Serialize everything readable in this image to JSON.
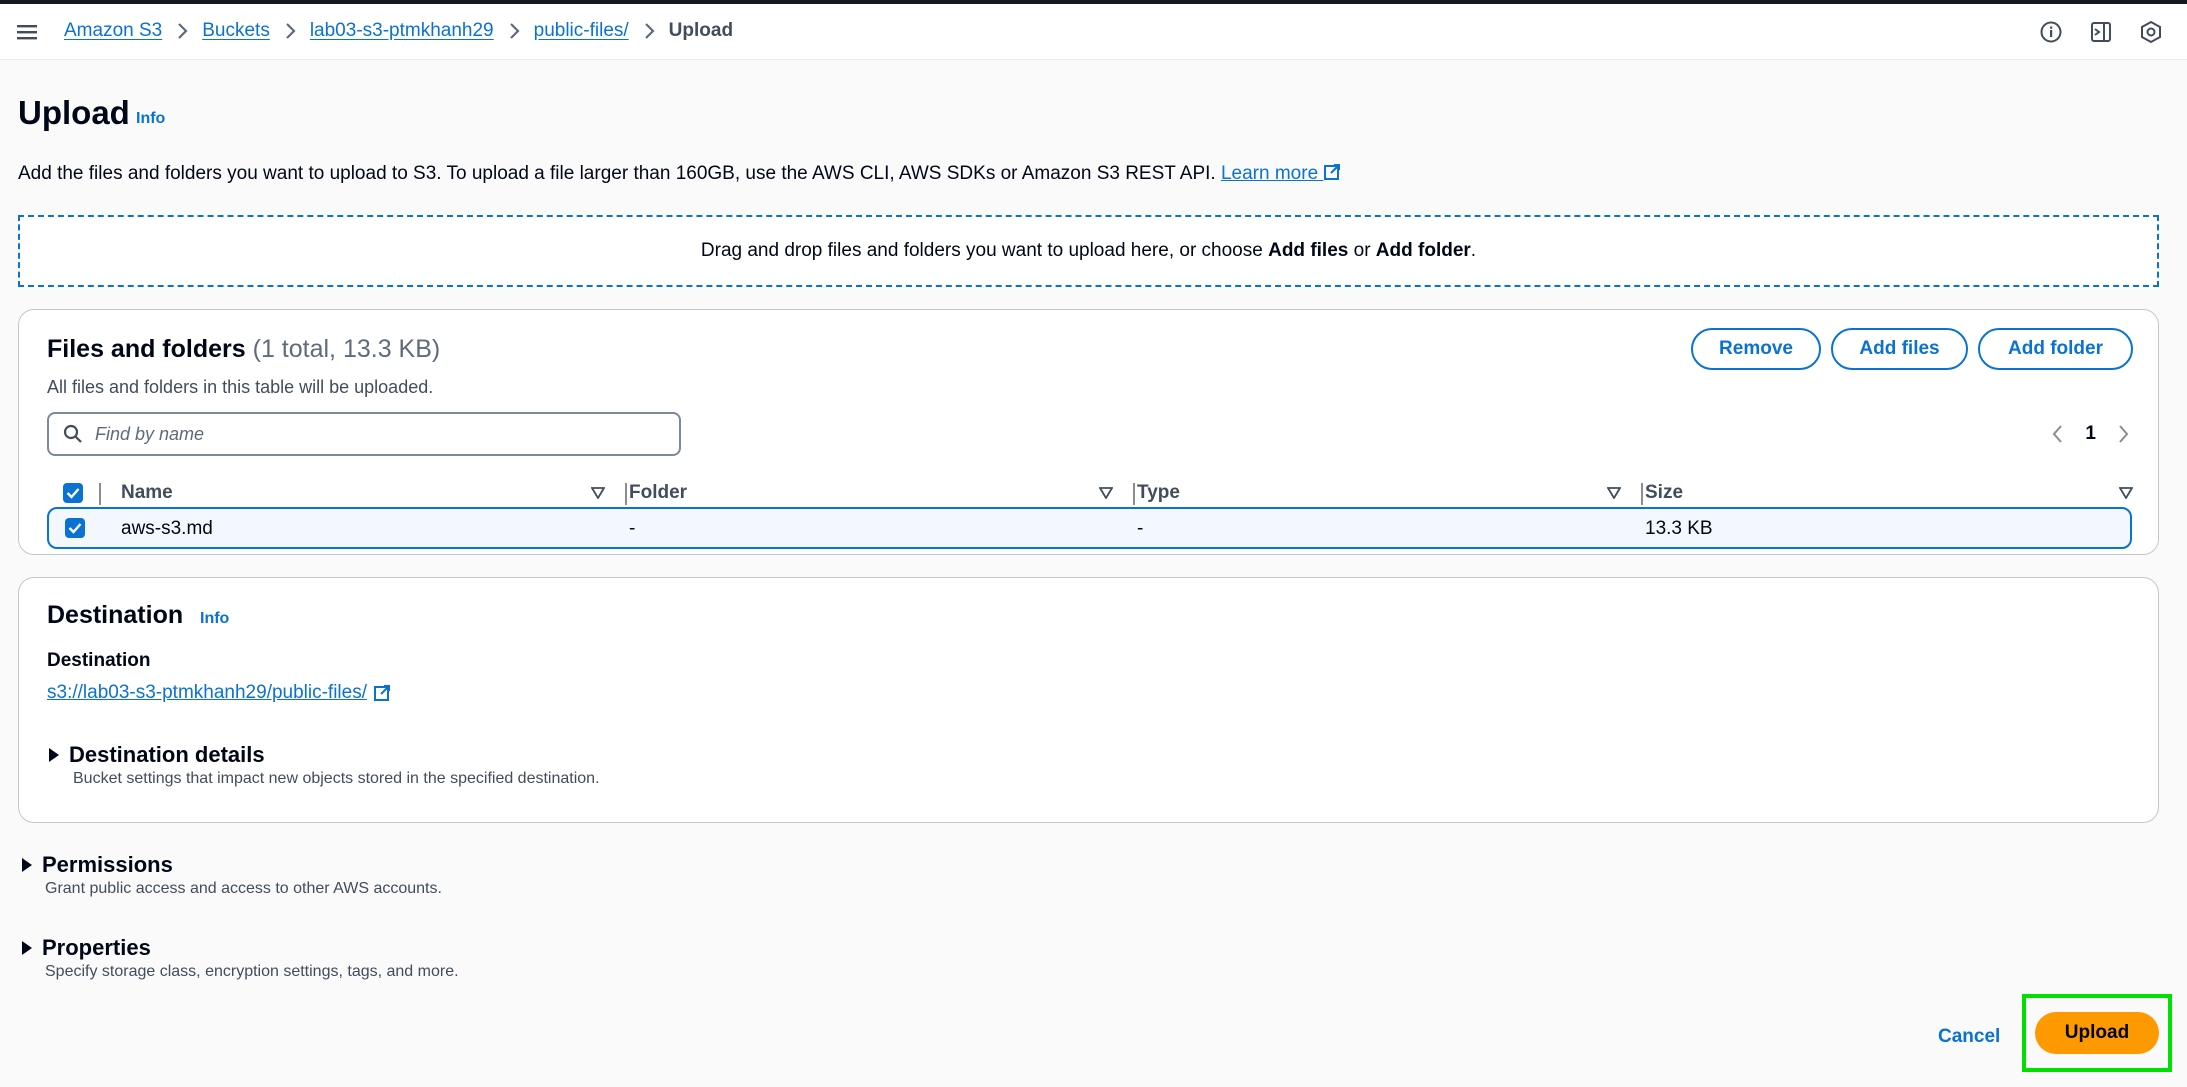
{
  "breadcrumb": {
    "items": [
      "Amazon S3",
      "Buckets",
      "lab03-s3-ptmkhanh29",
      "public-files/"
    ],
    "current": "Upload"
  },
  "page": {
    "title": "Upload",
    "info": "Info",
    "description": "Add the files and folders you want to upload to S3. To upload a file larger than 160GB, use the AWS CLI, AWS SDKs or Amazon S3 REST API.",
    "learn_more": "Learn more"
  },
  "dropzone": {
    "text_before": "Drag and drop files and folders you want to upload here, or choose ",
    "add_files": "Add files",
    "or": " or ",
    "add_folder": "Add folder",
    "period": "."
  },
  "files": {
    "title": "Files and folders",
    "count": "(1 total, 13.3 KB)",
    "subtitle": "All files and folders in this table will be uploaded.",
    "buttons": {
      "remove": "Remove",
      "add_files": "Add files",
      "add_folder": "Add folder"
    },
    "search_placeholder": "Find by name",
    "page": "1",
    "columns": [
      "Name",
      "Folder",
      "Type",
      "Size"
    ],
    "rows": [
      {
        "name": "aws-s3.md",
        "folder": "-",
        "type": "-",
        "size": "13.3 KB"
      }
    ]
  },
  "destination": {
    "title": "Destination",
    "info": "Info",
    "label": "Destination",
    "link": "s3://lab03-s3-ptmkhanh29/public-files/",
    "details_title": "Destination details",
    "details_desc": "Bucket settings that impact new objects stored in the specified destination."
  },
  "permissions": {
    "title": "Permissions",
    "desc": "Grant public access and access to other AWS accounts."
  },
  "properties": {
    "title": "Properties",
    "desc": "Specify storage class, encryption settings, tags, and more."
  },
  "actions": {
    "cancel": "Cancel",
    "upload": "Upload"
  },
  "colors": {
    "link": "#0972d3",
    "primary_button": "#ff9900",
    "highlight": "#00e000"
  }
}
